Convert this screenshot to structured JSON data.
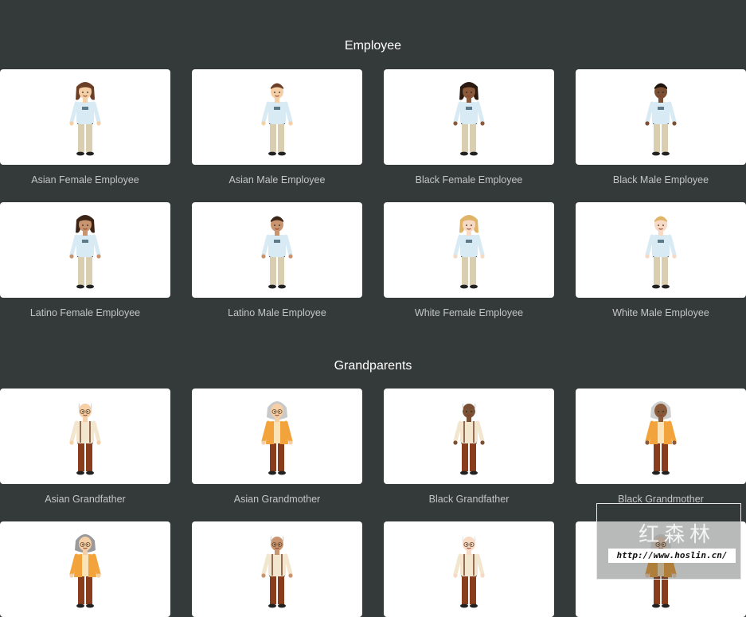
{
  "sections": [
    {
      "title": "Employee",
      "cards": [
        {
          "label": "Asian Female Employee",
          "skin": "#f5cfa6",
          "hair": "#6b3e26",
          "female": true,
          "style": "employee"
        },
        {
          "label": "Asian Male Employee",
          "skin": "#f5cfa6",
          "hair": "#6b3e26",
          "female": false,
          "style": "employee"
        },
        {
          "label": "Black Female Employee",
          "skin": "#8a5a3b",
          "hair": "#2b1a10",
          "female": true,
          "style": "employee"
        },
        {
          "label": "Black Male Employee",
          "skin": "#7a4f33",
          "hair": "#1e140d",
          "female": false,
          "style": "employee"
        },
        {
          "label": "Latino Female Employee",
          "skin": "#c99470",
          "hair": "#3b2416",
          "female": true,
          "style": "employee"
        },
        {
          "label": "Latino Male Employee",
          "skin": "#c99470",
          "hair": "#3b2416",
          "female": false,
          "style": "employee"
        },
        {
          "label": "White Female Employee",
          "skin": "#f7d9c4",
          "hair": "#e0b468",
          "female": true,
          "style": "employee"
        },
        {
          "label": "White Male Employee",
          "skin": "#f7d9c4",
          "hair": "#e0b468",
          "female": false,
          "style": "employee"
        }
      ]
    },
    {
      "title": "Grandparents",
      "cards": [
        {
          "label": "Asian Grandfather",
          "skin": "#f5cfa6",
          "hair": "#d7d7d7",
          "female": false,
          "style": "grandfather"
        },
        {
          "label": "Asian Grandmother",
          "skin": "#f5cfa6",
          "hair": "#c9c9c9",
          "female": true,
          "style": "grandmother"
        },
        {
          "label": "Black Grandfather",
          "skin": "#7a4f33",
          "hair": "#d0d0d0",
          "female": false,
          "style": "grandfather"
        },
        {
          "label": "Black Grandmother",
          "skin": "#8a5a3b",
          "hair": "#cfcfcf",
          "female": true,
          "style": "grandmother"
        },
        {
          "label": "",
          "skin": "#f5cfa6",
          "hair": "#9a9a9a",
          "female": true,
          "style": "grandmother"
        },
        {
          "label": "",
          "skin": "#c99470",
          "hair": "#d0d0d0",
          "female": false,
          "style": "grandfather"
        },
        {
          "label": "",
          "skin": "#f7d9c4",
          "hair": "#e6e6e6",
          "female": false,
          "style": "grandfather"
        },
        {
          "label": "",
          "skin": "#f7d9c4",
          "hair": "#e6e6e6",
          "female": true,
          "style": "grandmother"
        }
      ]
    }
  ],
  "colors": {
    "background": "#343a39",
    "card": "#ffffff",
    "caption": "#c3c6c5",
    "title": "#ffffff",
    "employee_shirt": "#d8eaf3",
    "employee_pants": "#d9cfb0",
    "grandfather_shirt": "#f3e6cf",
    "grandmother_cardigan": "#f3a33c",
    "grandparent_pants": "#8a3d1c"
  },
  "watermark": {
    "text_cn": "红森林",
    "url": "http://www.hoslin.cn/"
  }
}
